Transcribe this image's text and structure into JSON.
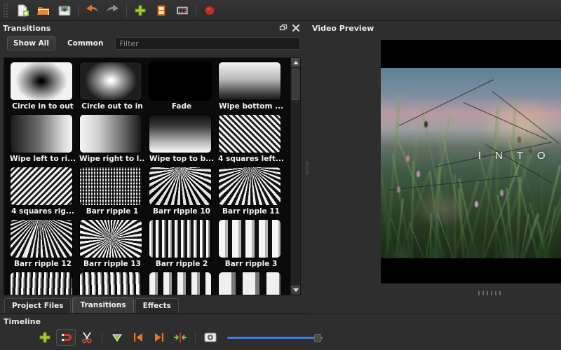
{
  "app": {
    "toolbar": {
      "buttons": [
        {
          "name": "new-project",
          "icon": "new-file-icon",
          "tooltip": "New Project"
        },
        {
          "name": "open-project",
          "icon": "open-folder-icon",
          "tooltip": "Open Project"
        },
        {
          "name": "save-project",
          "icon": "save-disk-icon",
          "tooltip": "Save Project"
        },
        {
          "name": "undo",
          "icon": "undo-arrow-icon",
          "tooltip": "Undo"
        },
        {
          "name": "redo",
          "icon": "redo-arrow-icon",
          "tooltip": "Redo"
        },
        {
          "name": "import-files",
          "icon": "plus-icon",
          "tooltip": "Import Files"
        },
        {
          "name": "profile",
          "icon": "film-strip-icon",
          "tooltip": "Choose Profile"
        },
        {
          "name": "fullscreen",
          "icon": "screen-icon",
          "tooltip": "Full Screen"
        },
        {
          "name": "export-video",
          "icon": "record-circle-icon",
          "tooltip": "Export Video"
        }
      ]
    }
  },
  "transitions_panel": {
    "title": "Transitions",
    "float_icon": "float-window-icon",
    "close_icon": "close-icon",
    "show_all_label": "Show All",
    "common_label": "Common",
    "filter_placeholder": "Filter",
    "filter_value": "",
    "scrollbar": {
      "up_icon": "arrow-up-icon",
      "down_icon": "arrow-down-icon",
      "position_percent": 2
    },
    "items": [
      {
        "label": "Circle in to out",
        "thumb": "circle-in-to-out"
      },
      {
        "label": "Circle out to in",
        "thumb": "circle-out-to-in"
      },
      {
        "label": "Fade",
        "thumb": "fade"
      },
      {
        "label": "Wipe bottom ...",
        "thumb": "wipe-bottom"
      },
      {
        "label": "Wipe left to ri...",
        "thumb": "wipe-left-to-right"
      },
      {
        "label": "Wipe right to l...",
        "thumb": "wipe-right-to-left"
      },
      {
        "label": "Wipe top to b...",
        "thumb": "wipe-top-to-bottom"
      },
      {
        "label": "4 squares left...",
        "thumb": "diagonal-stripes-left"
      },
      {
        "label": "4 squares rig...",
        "thumb": "diagonal-stripes-right"
      },
      {
        "label": "Barr ripple 1",
        "thumb": "ripple-dense-grid"
      },
      {
        "label": "Barr ripple 10",
        "thumb": "ripple-perspective-a"
      },
      {
        "label": "Barr ripple 11",
        "thumb": "ripple-perspective-b"
      },
      {
        "label": "Barr ripple 12",
        "thumb": "ripple-perspective-c"
      },
      {
        "label": "Barr ripple 13",
        "thumb": "ripple-radial"
      },
      {
        "label": "Barr ripple 2",
        "thumb": "ripple-vertical-thin"
      },
      {
        "label": "Barr ripple 3",
        "thumb": "ripple-vertical-wide"
      },
      {
        "label": "",
        "thumb": "ripple-wavy-a"
      },
      {
        "label": "",
        "thumb": "ripple-wavy-b"
      },
      {
        "label": "",
        "thumb": "ripple-blob-a"
      },
      {
        "label": "",
        "thumb": "ripple-blob-b"
      }
    ]
  },
  "dock_tabs": [
    {
      "label": "Project Files",
      "active": false
    },
    {
      "label": "Transitions",
      "active": true
    },
    {
      "label": "Effects",
      "active": false
    }
  ],
  "video_preview": {
    "title": "Video Preview",
    "overlay_text": "I N T O",
    "letterbox": true
  },
  "timeline": {
    "title": "Timeline",
    "buttons": [
      {
        "name": "add-track-button",
        "icon": "plus-icon",
        "framed": false
      },
      {
        "name": "snapping-toggle-button",
        "icon": "magnet-icon",
        "framed": true
      },
      {
        "name": "razor-tool-button",
        "icon": "scissors-icon",
        "framed": false
      },
      {
        "name": "add-marker-button",
        "icon": "marker-triangle-icon",
        "framed": false
      },
      {
        "name": "previous-marker-button",
        "icon": "skip-previous-icon",
        "framed": false
      },
      {
        "name": "next-marker-button",
        "icon": "skip-next-icon",
        "framed": false
      },
      {
        "name": "center-playhead-button",
        "icon": "center-playhead-icon",
        "framed": false
      },
      {
        "name": "snapshot-button",
        "icon": "snapshot-icon",
        "framed": false
      }
    ],
    "zoom_slider": {
      "name": "timeline-zoom-slider",
      "value_percent": 92
    }
  },
  "colors": {
    "window_bg": "#2e2e2e",
    "toolbar_bg": "#343434",
    "grid_bg": "#0b0b0b",
    "accent_blue": "#3b7ddd",
    "accent_orange": "#e8762c",
    "accent_green": "#9ccc2e",
    "accent_red": "#c0392b",
    "text": "#e8e8e8"
  }
}
